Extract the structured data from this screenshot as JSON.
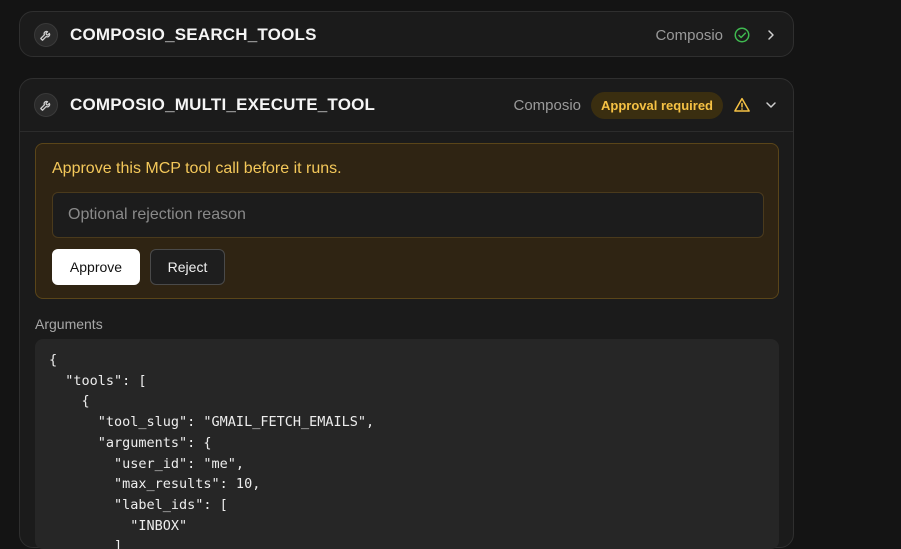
{
  "tools": [
    {
      "name": "COMPOSIO_SEARCH_TOOLS",
      "provider": "Composio",
      "status_icon": "check-circle-icon",
      "expand_icon": "chevron-right-icon"
    },
    {
      "name": "COMPOSIO_MULTI_EXECUTE_TOOL",
      "provider": "Composio",
      "badge": "Approval required",
      "status_icon": "warning-triangle-icon",
      "expand_icon": "chevron-down-icon"
    }
  ],
  "approval": {
    "prompt": "Approve this MCP tool call before it runs.",
    "reason_placeholder": "Optional rejection reason",
    "reason_value": "",
    "approve_label": "Approve",
    "reject_label": "Reject"
  },
  "arguments": {
    "label": "Arguments",
    "code": "{\n  \"tools\": [\n    {\n      \"tool_slug\": \"GMAIL_FETCH_EMAILS\",\n      \"arguments\": {\n        \"user_id\": \"me\",\n        \"max_results\": 10,\n        \"label_ids\": [\n          \"INBOX\"\n        ]\n      }\n    }\n  ]\n}"
  },
  "colors": {
    "success": "#3fb950",
    "warning": "#f6c244",
    "background": "#141414"
  }
}
